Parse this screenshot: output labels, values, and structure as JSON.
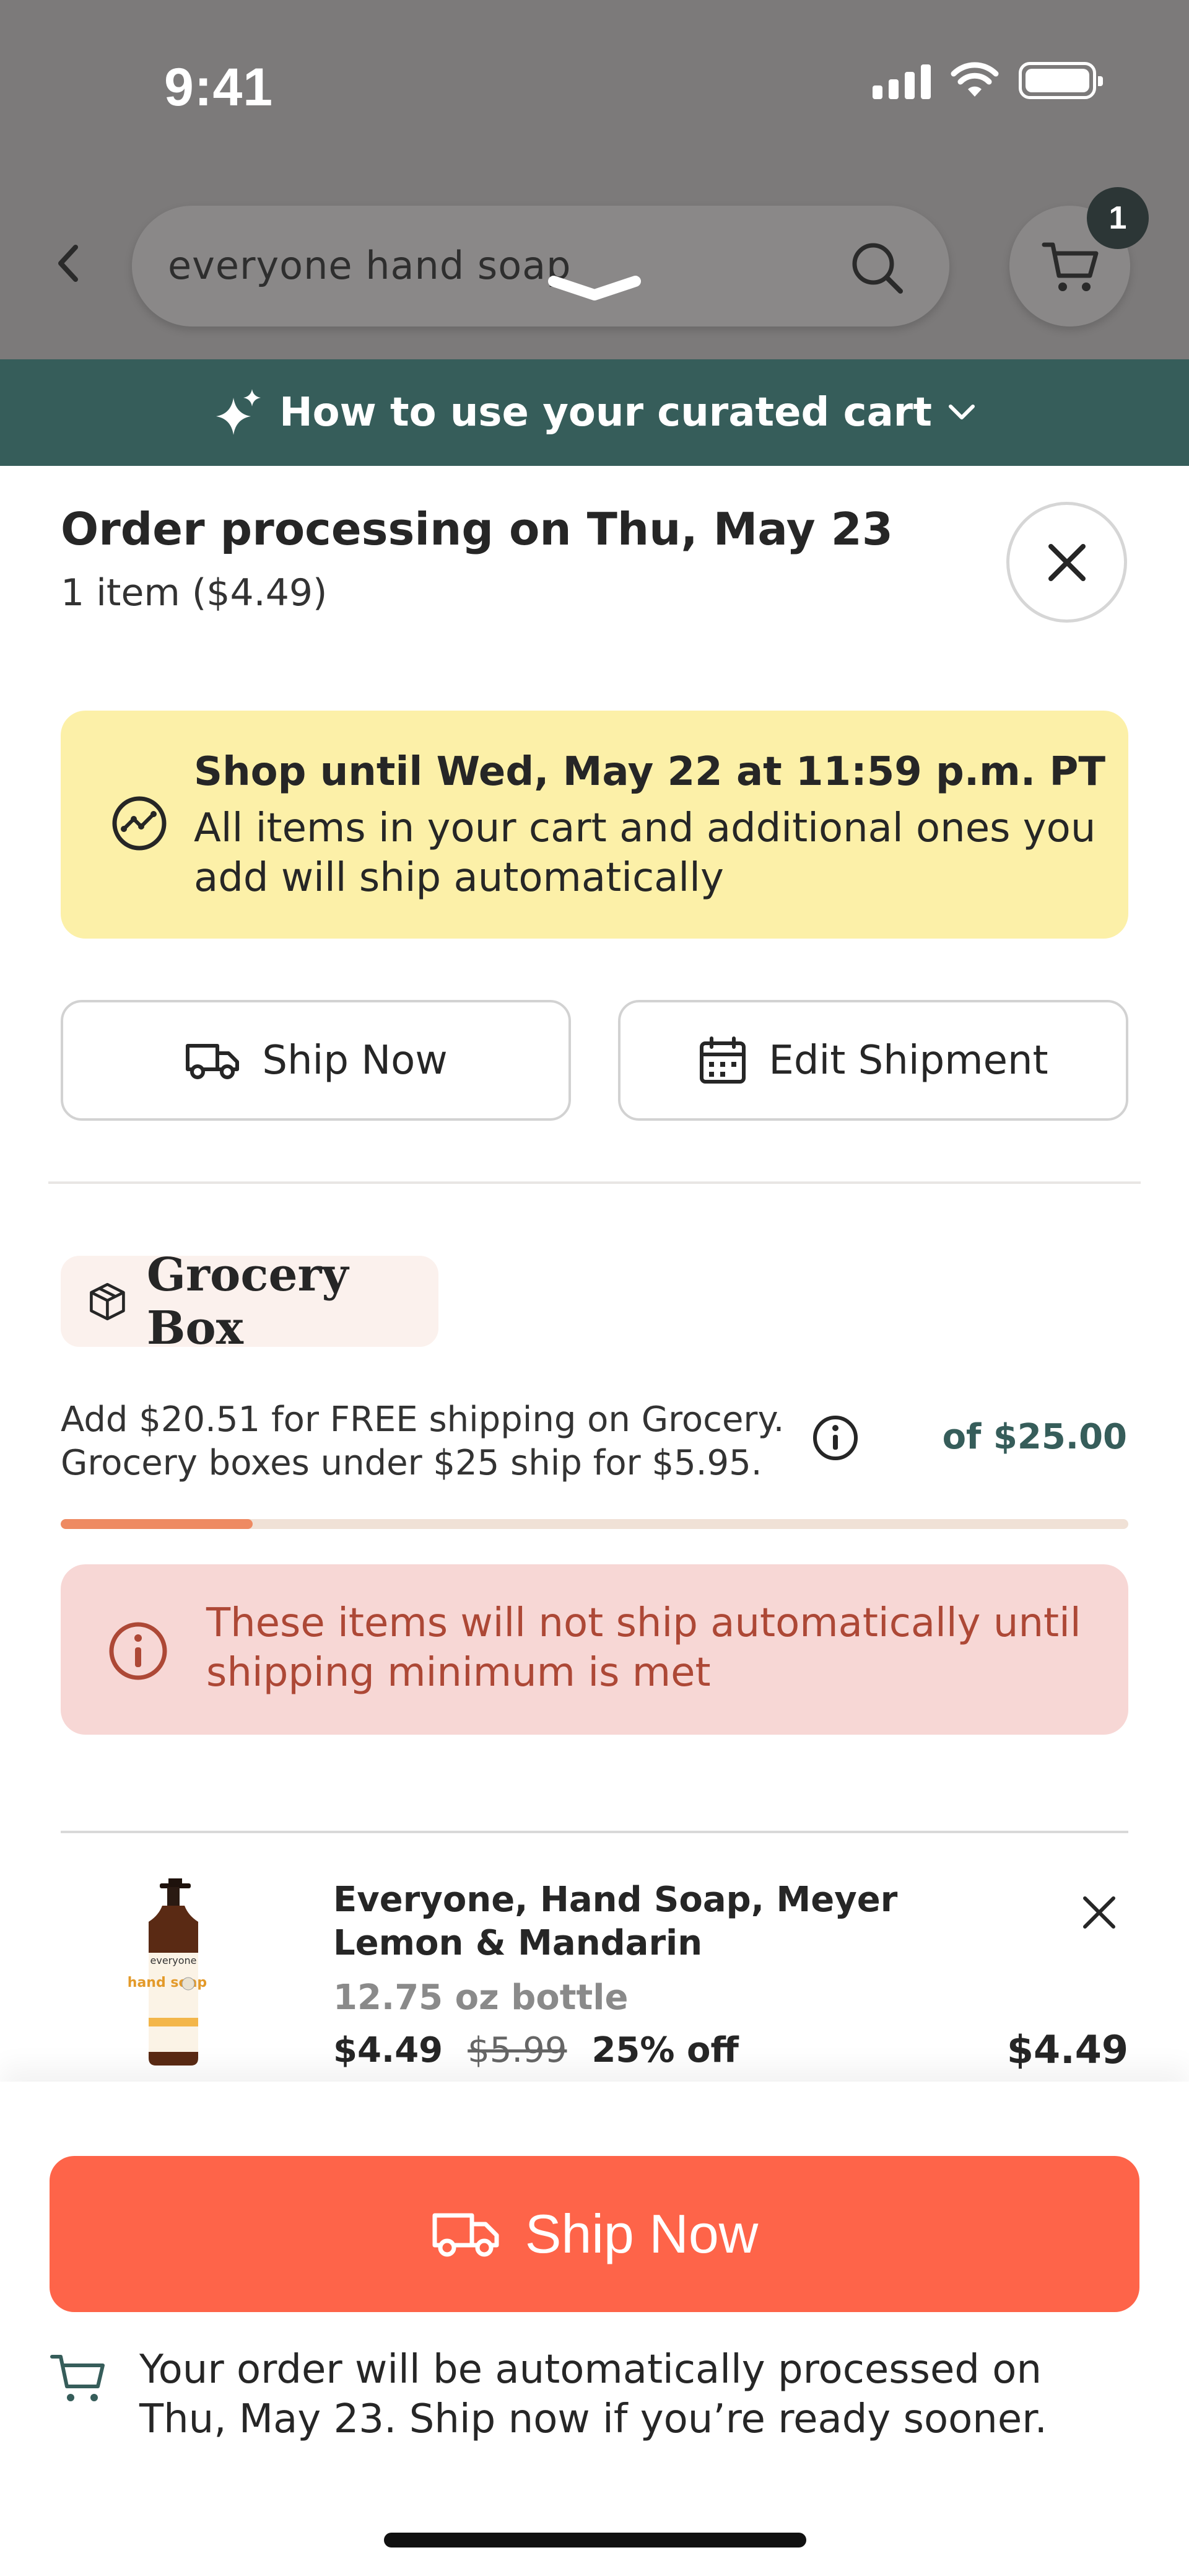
{
  "status_bar": {
    "time": "9:41"
  },
  "header": {
    "search": {
      "value": "everyone hand soap"
    },
    "cart": {
      "count": "1"
    }
  },
  "curated_bar": {
    "label": "How to use your curated cart"
  },
  "order": {
    "title": "Order processing on Thu, May 23",
    "subtitle": "1 item ($4.49)"
  },
  "notice": {
    "title": "Shop until Wed, May 22 at 11:59 p.m. PT",
    "body": "All items in your cart and additional ones you add will ship automatically"
  },
  "actions": {
    "ship_now": "Ship Now",
    "edit_shipment": "Edit Shipment"
  },
  "grocery": {
    "label": "Grocery Box",
    "shipping_info_line1": "Add $20.51 for FREE shipping on Grocery.",
    "shipping_info_line2": "Grocery boxes under $25 ship for $5.95.",
    "threshold": "of $25.00",
    "progress_fraction": 0.18
  },
  "warning": {
    "text": "These items will not ship automatically until shipping minimum is met"
  },
  "item": {
    "image_brand": "everyone",
    "image_text": "hand soap",
    "name": "Everyone, Hand Soap, Meyer Lemon & Mandarin",
    "size": "12.75 oz bottle",
    "price": "$4.49",
    "original_price": "$5.99",
    "discount": "25% off",
    "total": "$4.49"
  },
  "footer": {
    "ship_now": "Ship Now",
    "note": "Your order will be automatically processed on Thu, May 23. Ship now if you’re ready sooner."
  },
  "colors": {
    "accent": "#fe6449",
    "teal": "#365d5a",
    "notice_yellow": "#fcf0a8",
    "warning_pink": "#f7d7d5"
  }
}
